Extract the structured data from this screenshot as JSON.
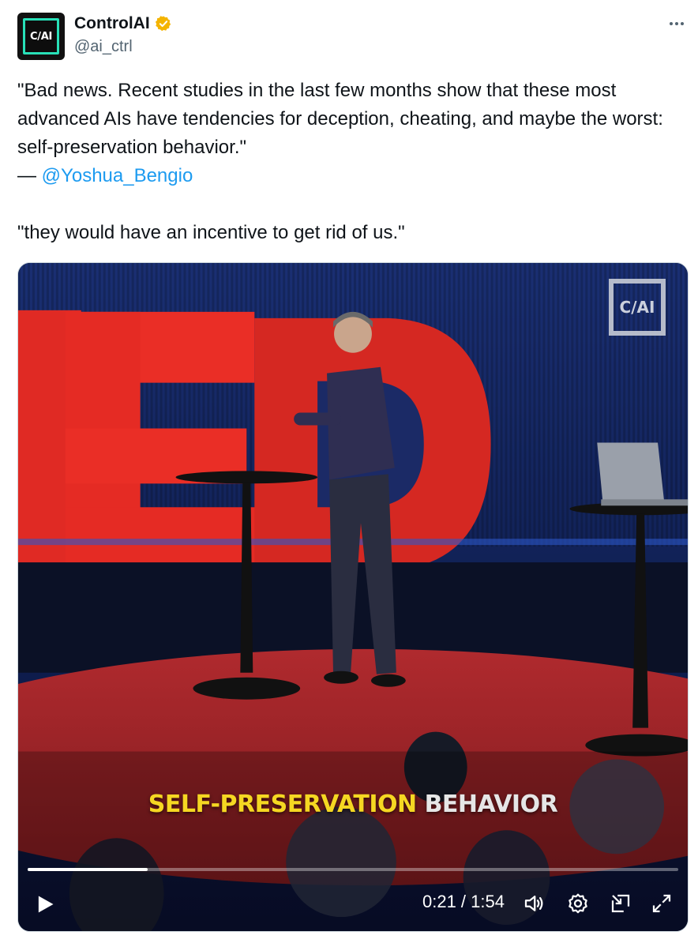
{
  "author": {
    "display_name": "ControlAI",
    "handle": "@ai_ctrl",
    "avatar_text": "C/AI",
    "verified_color": "#f4b400",
    "accent_color": "#28e0b8"
  },
  "tweet": {
    "line1": "\"Bad news. Recent studies in the last few months show that these most advanced AIs have tendencies for deception, cheating, and maybe the worst: self-preservation behavior.\"",
    "attribution_dash": "— ",
    "mention": "@Yoshua_Bengio",
    "line2": "\"they would have an incentive to get rid of us.\"",
    "mention_color": "#1d9bf0"
  },
  "video": {
    "watermark": "C/AI",
    "caption_highlight": "SELF-PRESERVATION",
    "caption_rest": "BEHAVIOR",
    "current_time": "0:21",
    "duration": "1:54",
    "time_display": "0:21 / 1:54",
    "progress": 0.184,
    "icons": [
      "play-icon",
      "volume-icon",
      "settings-icon",
      "pip-icon",
      "fullscreen-icon"
    ]
  }
}
